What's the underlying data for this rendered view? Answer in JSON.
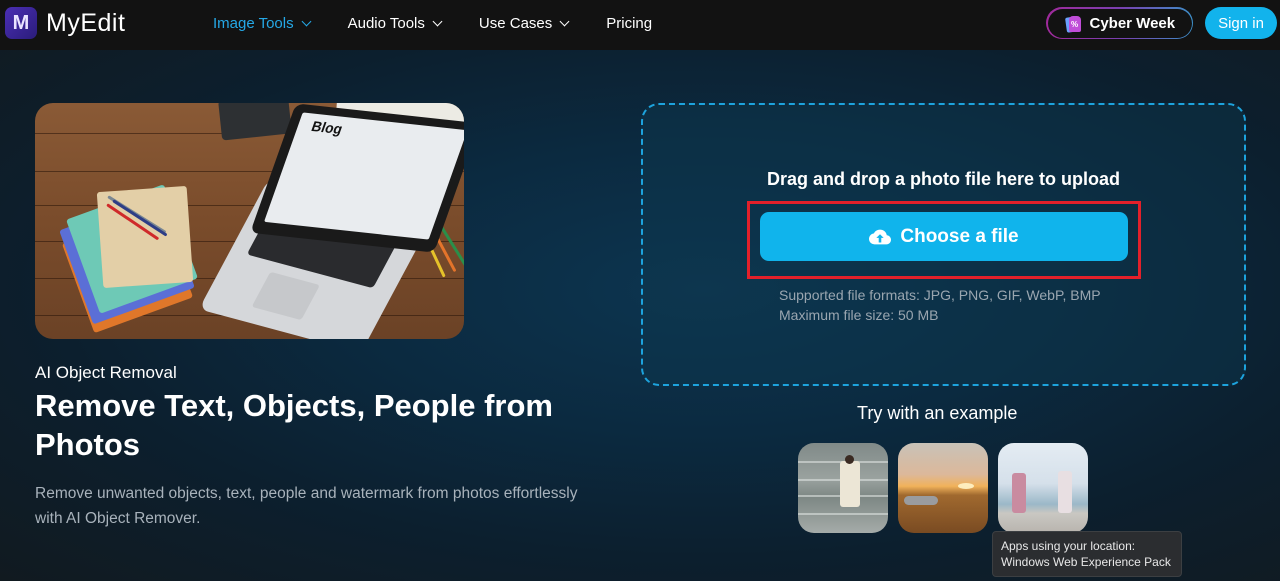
{
  "nav": {
    "brand": "MyEdit",
    "brand_mark": "M",
    "links": [
      {
        "label": "Image Tools",
        "active": true,
        "dropdown": true
      },
      {
        "label": "Audio Tools",
        "active": false,
        "dropdown": true
      },
      {
        "label": "Use Cases",
        "active": false,
        "dropdown": true
      },
      {
        "label": "Pricing",
        "active": false,
        "dropdown": false
      }
    ],
    "promo": {
      "label": "Cyber Week",
      "icon": "shopping-tag-icon",
      "tag_symbol": "%"
    },
    "signin_label": "Sign in"
  },
  "colors": {
    "accent": "#12b3ec",
    "active_nav": "#25a8e6",
    "highlight_border": "#e3202a",
    "dropzone_border": "#1da3dd"
  },
  "hero": {
    "image_alt": "Laptop showing Blog on wooden desk",
    "image_blog_text": "Blog",
    "subtitle": "AI Object Removal",
    "title": "Remove Text, Objects, People from Photos",
    "description": "Remove unwanted objects, text, people and watermark from photos effortlessly with AI Object Remover."
  },
  "upload": {
    "drop_label": "Drag and drop a photo file here to upload",
    "button_label": "Choose a file",
    "button_icon": "cloud-upload-icon",
    "formats": "Supported file formats: JPG, PNG, GIF, WebP, BMP",
    "max_size": "Maximum file size: 50 MB"
  },
  "examples": {
    "label": "Try with an example",
    "items": [
      {
        "alt": "Man in white suit sitting on stairs"
      },
      {
        "alt": "Car in field at sunset"
      },
      {
        "alt": "Two women walking on seawall"
      }
    ]
  },
  "tooltip": {
    "line1": "Apps using your location:",
    "line2": "Windows Web Experience Pack"
  }
}
